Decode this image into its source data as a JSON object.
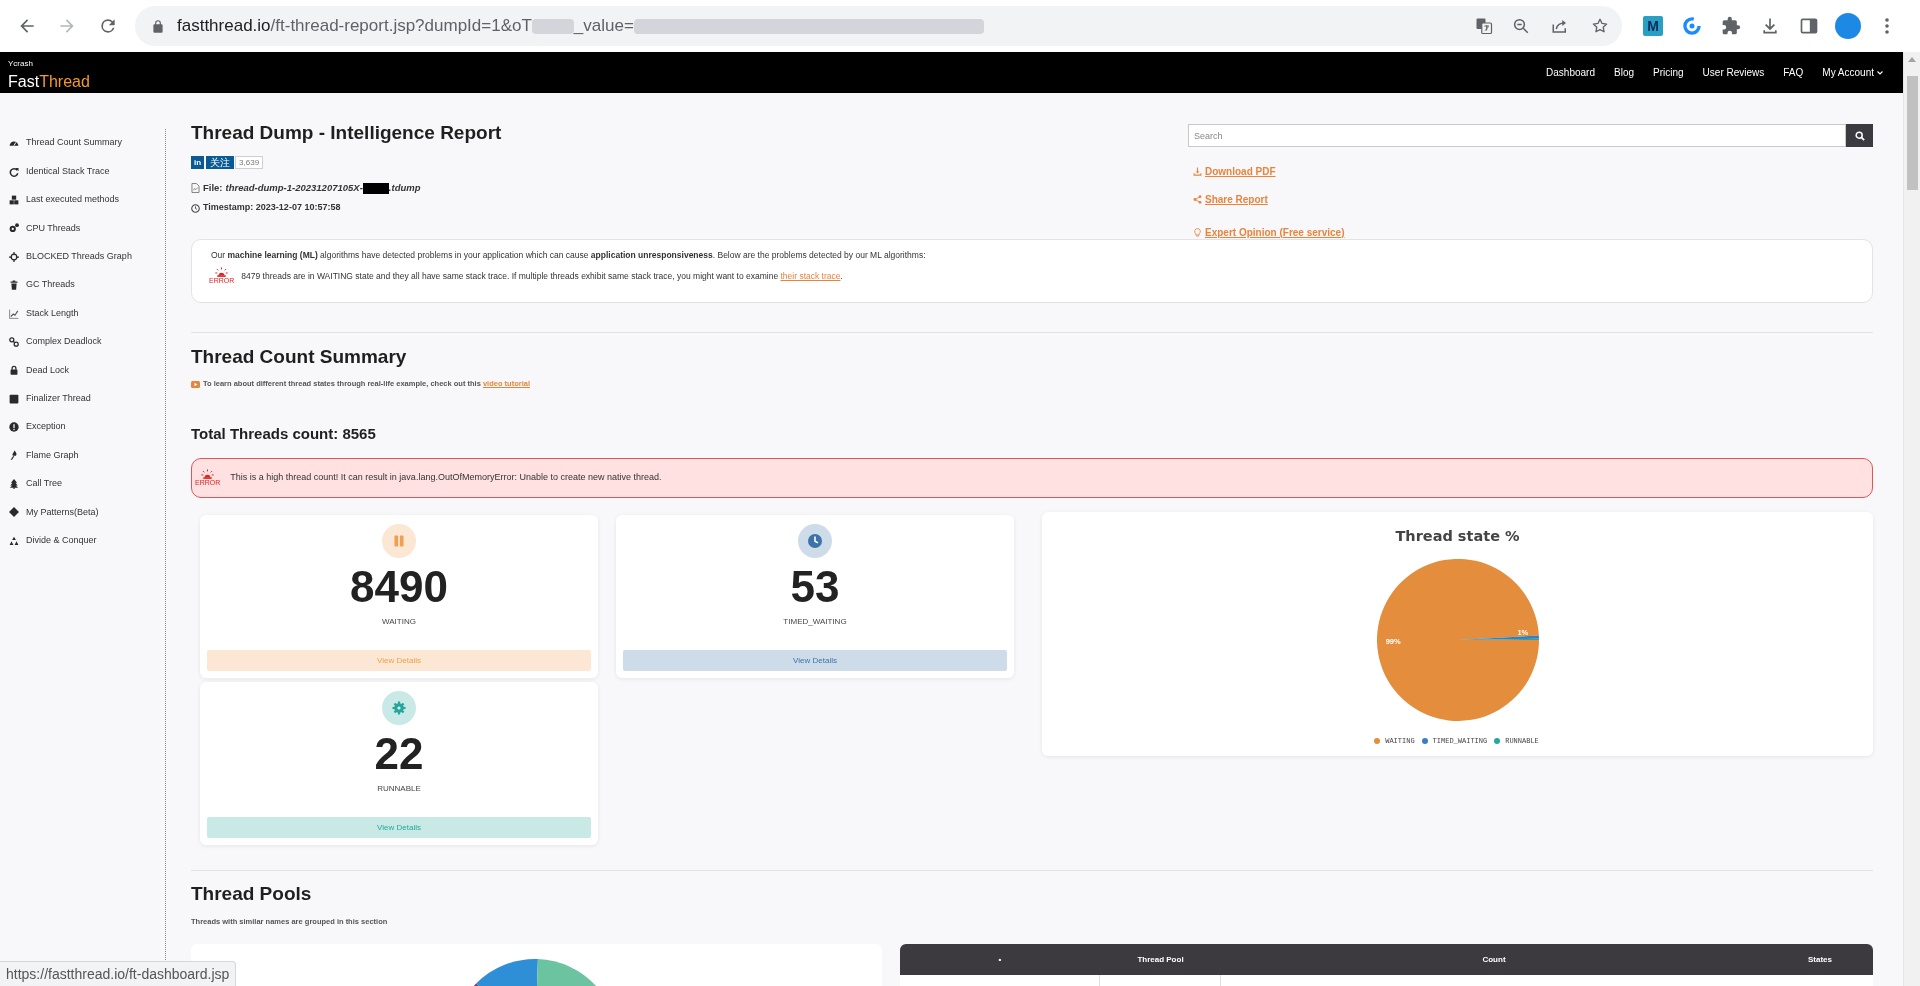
{
  "browser": {
    "address_parts": [
      {
        "kind": "host",
        "text": "fastthread.io"
      },
      {
        "kind": "path",
        "text": "/ft-thread-report.jsp?dumpId=1&oT"
      },
      {
        "kind": "blurred"
      },
      {
        "kind": "path",
        "text": "_value="
      },
      {
        "kind": "blurred"
      }
    ],
    "extension_badge": "M"
  },
  "site_header": {
    "logo": {
      "tagline": "Ycrash",
      "name_parts": [
        {
          "text": "Fast",
          "accent": false
        },
        {
          "text": "Thread",
          "accent": true
        }
      ]
    },
    "nav": [
      {
        "label": "Dashboard",
        "dropdown": false
      },
      {
        "label": "Blog",
        "dropdown": false
      },
      {
        "label": "Pricing",
        "dropdown": false
      },
      {
        "label": "User Reviews",
        "dropdown": false
      },
      {
        "label": "FAQ",
        "dropdown": false
      },
      {
        "label": "My Account",
        "dropdown": true
      }
    ]
  },
  "sidebar": {
    "items": [
      {
        "label": "Thread Count Summary"
      },
      {
        "label": "Identical Stack Trace"
      },
      {
        "label": "Last executed methods"
      },
      {
        "label": "CPU Threads"
      },
      {
        "label": "BLOCKED Threads Graph"
      },
      {
        "label": "GC Threads"
      },
      {
        "label": "Stack Length"
      },
      {
        "label": "Complex Deadlock"
      },
      {
        "label": "Dead Lock"
      },
      {
        "label": "Finalizer Thread"
      },
      {
        "label": "Exception"
      },
      {
        "label": "Flame Graph"
      },
      {
        "label": "Call Tree"
      },
      {
        "label": "My Patterns(Beta)"
      },
      {
        "label": "Divide & Conquer"
      }
    ]
  },
  "report": {
    "title": "Thread Dump - Intelligence Report",
    "linkedin": {
      "logo": "in",
      "action": "关注",
      "count": "3,639"
    },
    "file": {
      "label": "File:",
      "name_parts": [
        {
          "kind": "text",
          "text": "thread-dump-1-20231207105X-"
        },
        {
          "kind": "redacted"
        },
        {
          "kind": "text",
          "text": ".tdump"
        }
      ]
    },
    "timestamp": "Timestamp: 2023-12-07 10:57:58",
    "search": {
      "placeholder": "Search"
    },
    "links": [
      {
        "label": "Download PDF"
      },
      {
        "label": "Share Report"
      },
      {
        "label": "Expert Opinion (Free service)"
      }
    ]
  },
  "ml_notice": {
    "intro": "Our **machine learning (ML)** algorithms have detected problems in your application which can cause **application unresponsiveness**. Below are the problems detected by our ML algorithms:",
    "problems": [
      {
        "badge": "ERROR",
        "text": "8479 threads are in WAITING state and they all have same stack trace. If multiple threads exhibit same stack trace, you might want to examine",
        "link": "their stack trace",
        "suffix": "."
      }
    ]
  },
  "thread_count_summary": {
    "title": "Thread Count Summary",
    "tutorial_note": {
      "text": "To learn about different thread states through real-life example, check out this",
      "link": "video tutorial"
    },
    "total": "Total Threads count: 8565",
    "alert": {
      "badge": "ERROR",
      "text": "This is a high thread count! It can result in java.lang.OutOfMemoryError: Unable to create new native thread."
    },
    "state_cards": [
      {
        "kind": "waiting",
        "count": "8490",
        "label": "WAITING",
        "button": "View Details",
        "color": "#eea04f"
      },
      {
        "kind": "timed_waiting",
        "count": "53",
        "label": "TIMED_WAITING",
        "button": "View Details",
        "color": "#3d73a8"
      },
      {
        "kind": "runnable",
        "count": "22",
        "label": "RUNNABLE",
        "button": "View Details",
        "color": "#26a69a"
      }
    ],
    "chart": {
      "chart_data": {
        "type": "pie",
        "title": "Thread state %",
        "categories": [
          "WAITING",
          "TIMED_WAITING",
          "RUNNABLE"
        ],
        "values": [
          99.12,
          0.62,
          0.26
        ],
        "colors": [
          "#e38d3d",
          "#3b7dc0",
          "#27a69a"
        ],
        "value_labels": [
          "99%",
          "1%",
          null
        ],
        "legend": "bottom"
      }
    }
  },
  "thread_pools": {
    "title": "Thread Pools",
    "subtitle": "Threads with similar names are grouped in this section",
    "table": {
      "columns": [
        "•",
        "Thread Pool",
        "Count",
        "States"
      ]
    }
  },
  "status_bar": {
    "url": "https://fastthread.io/ft-dashboard.jsp"
  }
}
